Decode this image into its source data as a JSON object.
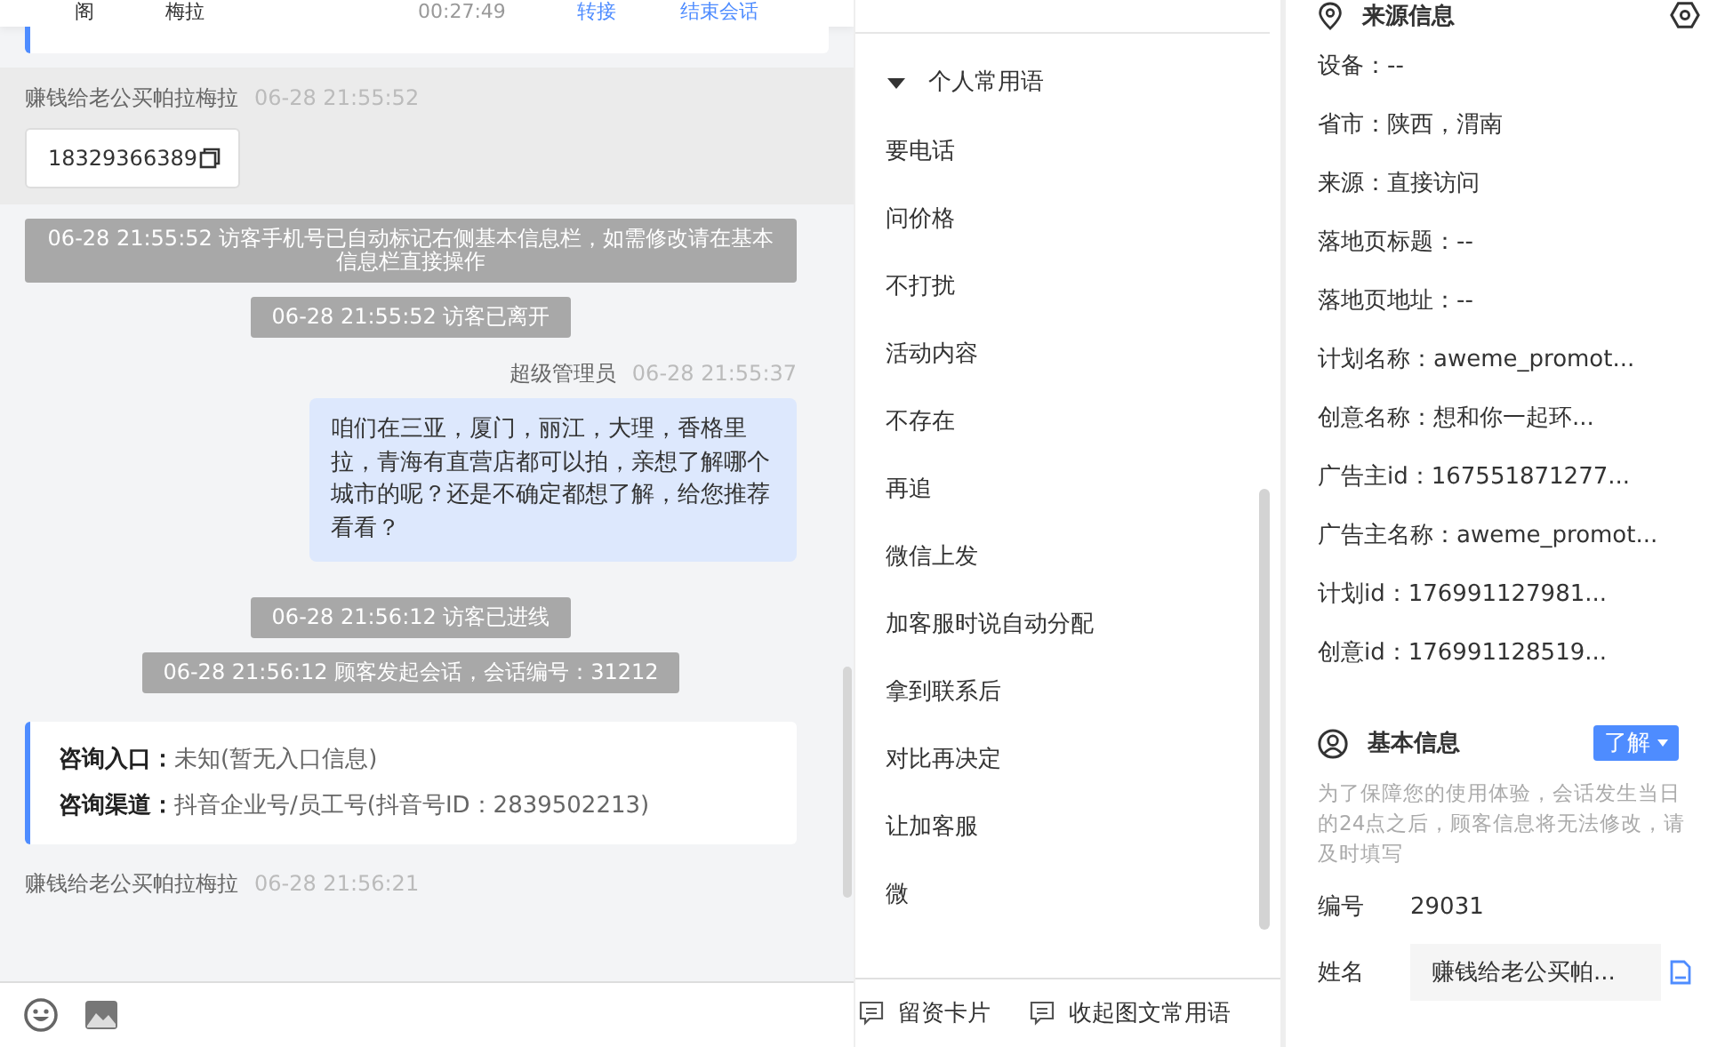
{
  "chat_header": {
    "cells": [
      "阁",
      "梅拉",
      "00:27:49"
    ],
    "actions": [
      "转接",
      "结束会话"
    ]
  },
  "messages": [
    {
      "kind": "card_tail"
    },
    {
      "kind": "visitor",
      "name": "赚钱给老公买帕拉梅拉",
      "time": "06-28 21:55:52",
      "phone": "18329366389"
    },
    {
      "kind": "system",
      "text": "06-28 21:55:52 访客手机号已自动标记右侧基本信息栏，如需修改请在基本信息栏直接操作"
    },
    {
      "kind": "system",
      "text": "06-28 21:55:52 访客已离开"
    },
    {
      "kind": "agent",
      "name": "超级管理员",
      "time": "06-28 21:55:37",
      "text": "咱们在三亚，厦门，丽江，大理，香格里拉，青海有直营店都可以拍，亲想了解哪个城市的呢？还是不确定都想了解，给您推荐看看？"
    },
    {
      "kind": "system",
      "text": "06-28 21:56:12 访客已进线"
    },
    {
      "kind": "system",
      "text": "06-28 21:56:12 顾客发起会话，会话编号：31212"
    },
    {
      "kind": "info_card",
      "rows": [
        {
          "label": "咨询入口：",
          "value": "未知(暂无入口信息)"
        },
        {
          "label": "咨询渠道：",
          "value": "抖音企业号/员工号(抖音号ID：2839502213)"
        }
      ]
    },
    {
      "kind": "visitor_header",
      "name": "赚钱给老公买帕拉梅拉",
      "time": "06-28 21:56:21"
    }
  ],
  "phrases": {
    "group": {
      "title": "个人常用语",
      "expanded": true
    },
    "items": [
      "要电话",
      "问价格",
      "不打扰",
      "活动内容",
      "不存在",
      "再追",
      "微信上发",
      "加客服时说自动分配",
      "拿到联系后",
      "对比再决定",
      "让加客服",
      "微"
    ],
    "footer": [
      "留资卡片",
      "收起图文常用语"
    ]
  },
  "source_info": {
    "title": "来源信息",
    "fields": [
      "设备：--",
      "省市：陕西，渭南",
      "来源：直接访问",
      "落地页标题：--",
      "落地页地址：--",
      "计划名称：aweme_promot...",
      "创意名称：想和你一起环...",
      "广告主id：167551871277...",
      "广告主名称：aweme_promot...",
      "计划id：176991127981...",
      "创意id：176991128519..."
    ]
  },
  "basic_info": {
    "title": "基本信息",
    "button": "了解",
    "note": "为了保障您的使用体验，会话发生当日的24点之后，顾客信息将无法修改，请及时填写",
    "fields": [
      {
        "kind": "text",
        "label": "编号",
        "value": "29031"
      },
      {
        "kind": "input",
        "label": "姓名",
        "value": "赚钱给老公买帕..."
      }
    ]
  }
}
